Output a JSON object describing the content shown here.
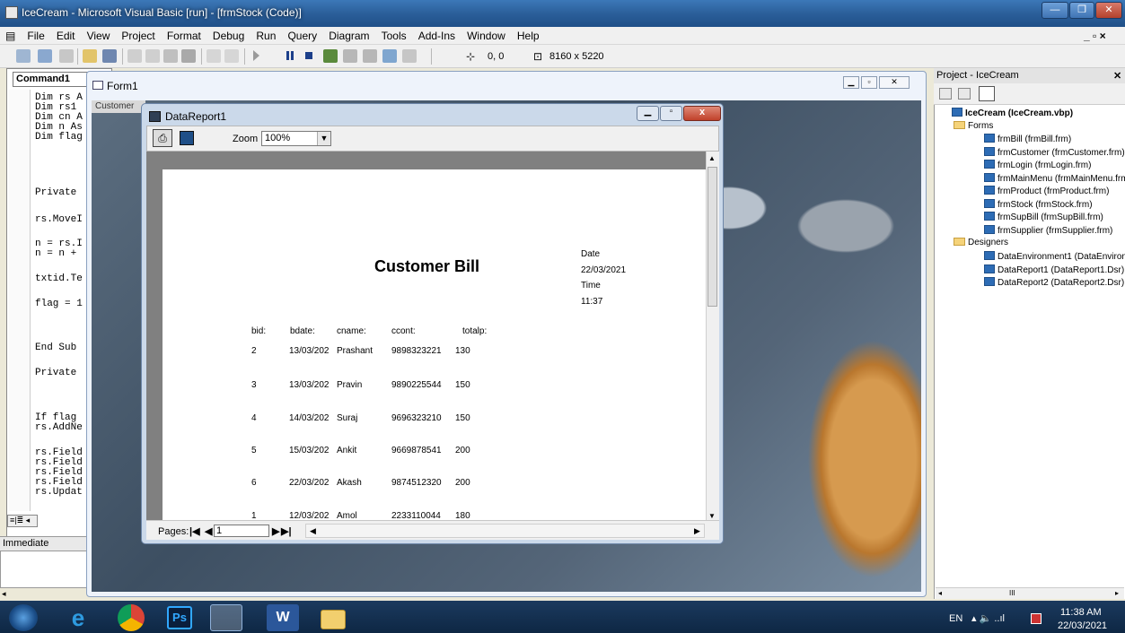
{
  "window": {
    "title": "IceCream - Microsoft Visual Basic [run] - [frmStock (Code)]"
  },
  "menu": [
    "File",
    "Edit",
    "View",
    "Project",
    "Format",
    "Debug",
    "Run",
    "Query",
    "Diagram",
    "Tools",
    "Add-Ins",
    "Window",
    "Help"
  ],
  "toolbar": {
    "position": "0, 0",
    "size": "8160 x 5220"
  },
  "code": {
    "object_combo": "Command1",
    "lines": [
      "Dim rs A",
      "Dim rs1",
      "Dim cn A",
      "Dim n As",
      "Dim flag",
      "",
      "Private",
      "",
      "rs.MoveI",
      "",
      "n = rs.I",
      "n = n +",
      "",
      "txtid.Te",
      "",
      "flag = 1",
      "",
      "",
      "End Sub",
      "",
      "Private",
      "",
      "",
      "If flag",
      "rs.AddNe",
      "",
      "rs.Field",
      "rs.Field",
      "rs.Field",
      "rs.Field",
      "rs.Updat"
    ]
  },
  "immediate": {
    "title": "Immediate"
  },
  "form1": {
    "title": "Form1",
    "subtitle": "Customer"
  },
  "datareport": {
    "title": "DataReport1",
    "zoom_label": "Zoom",
    "zoom_value": "100%",
    "report_title": "Customer Bill",
    "date_label": "Date",
    "date_value": "22/03/2021",
    "time_label": "Time",
    "time_value": "11:37",
    "headers": [
      "bid:",
      "bdate:",
      "cname:",
      "ccont:",
      "totalp:"
    ],
    "rows": [
      [
        "2",
        "13/03/202",
        "Prashant",
        "9898323221",
        "130"
      ],
      [
        "3",
        "13/03/202",
        "Pravin",
        "9890225544",
        "150"
      ],
      [
        "4",
        "14/03/202",
        "Suraj",
        "9696323210",
        "150"
      ],
      [
        "5",
        "15/03/202",
        "Ankit",
        "9669878541",
        "200"
      ],
      [
        "6",
        "22/03/202",
        "Akash",
        "9874512320",
        "200"
      ],
      [
        "1",
        "12/03/202",
        "Amol",
        "2233110044",
        "180"
      ]
    ],
    "pages_label": "Pages:",
    "page_number": "1"
  },
  "project": {
    "title": "Project - IceCream",
    "root": "IceCream (IceCream.vbp)",
    "forms_folder": "Forms",
    "forms": [
      "frmBill (frmBill.frm)",
      "frmCustomer (frmCustomer.frm)",
      "frmLogin (frmLogin.frm)",
      "frmMainMenu (frmMainMenu.frm)",
      "frmProduct (frmProduct.frm)",
      "frmStock (frmStock.frm)",
      "frmSupBill (frmSupBill.frm)",
      "frmSupplier (frmSupplier.frm)"
    ],
    "designers_folder": "Designers",
    "designers": [
      "DataEnvironment1 (DataEnvironment1.Dsr)",
      "DataReport1 (DataReport1.Dsr)",
      "DataReport2 (DataReport2.Dsr)"
    ],
    "scroll_marker": "III"
  },
  "taskbar": {
    "lang": "EN",
    "time": "11:38 AM",
    "date": "22/03/2021",
    "ps_label": "Ps",
    "word_label": "W"
  },
  "colors": {
    "titlebar": "#2b5f9a",
    "taskbar": "#0e2744",
    "report_bg": "#808080"
  }
}
